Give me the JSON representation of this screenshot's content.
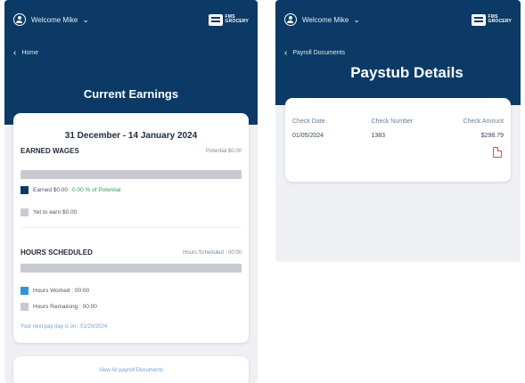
{
  "left": {
    "header": {
      "welcome": "Welcome Mike",
      "logo_top": "FMS",
      "logo_bottom": "GROCERY",
      "back_label": "Home",
      "title": "Current Earnings"
    },
    "earnings": {
      "period": "31 December - 14 January 2024",
      "earned_wages_title": "EARNED WAGES",
      "potential": "Potential $0.00",
      "earned_label": "Earned $0.00",
      "earned_pct": "0.00 % of Potential",
      "yet_to_earn": "Yet to earn $0.00",
      "hours_title": "HOURS SCHEDULED",
      "hours_scheduled": "Hours Scheduled : 00:00",
      "hours_worked": "Hours Worked : 00:00",
      "hours_remaining": "Hours Remaining : 00:00",
      "next_pay_day": "Your next pay day is on : 01/20/2024",
      "earned_progress": 0
    },
    "links": {
      "view_all": "View All payroll Documents"
    }
  },
  "right": {
    "header": {
      "welcome": "Welcome Mike",
      "logo_top": "FMS",
      "logo_bottom": "GROCERY",
      "back_label": "Payroll Documents",
      "title": "Paystub Details"
    },
    "table": {
      "columns": [
        "Check Date",
        "Check Number",
        "Check Amount"
      ],
      "rows": [
        {
          "date": "01/05/2024",
          "number": "1383",
          "amount": "$298.79"
        }
      ]
    }
  },
  "colors": {
    "header_bg": "#0b3a66",
    "earned_swatch": "#0b3a66",
    "yet_swatch": "#c7cbd1",
    "worked_swatch": "#2f95d6",
    "remaining_swatch": "#c7cbd1",
    "link": "#6f9fd4",
    "pdf": "#d94a4a"
  },
  "icons": {
    "user": "user-circle-icon",
    "chevron": "chevron-down-icon",
    "back": "chevron-left-icon",
    "pdf": "pdf-file-icon",
    "logo": "fms-grocery-logo"
  }
}
